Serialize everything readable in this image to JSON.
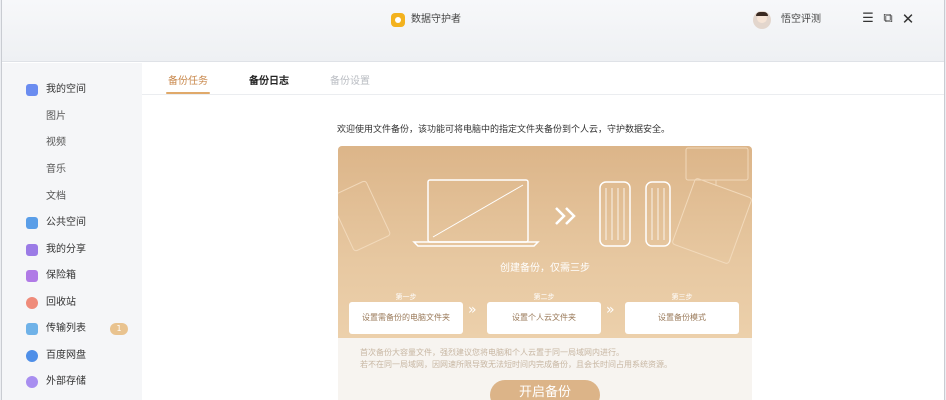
{
  "app": {
    "title": "数据守护者",
    "user_name": "悟空评测"
  },
  "window_controls": {
    "menu": "☰",
    "restore": "⧉",
    "close": "✕"
  },
  "sidebar": {
    "items": [
      {
        "label": "我的空间",
        "icon": "cloud-space-icon",
        "color": "#6a8cf0"
      },
      {
        "label": "图片",
        "sub": true
      },
      {
        "label": "视频",
        "sub": true
      },
      {
        "label": "音乐",
        "sub": true
      },
      {
        "label": "文档",
        "sub": true
      },
      {
        "label": "公共空间",
        "icon": "send-icon",
        "color": "#5a9ee8"
      },
      {
        "label": "我的分享",
        "icon": "share-icon",
        "color": "#9b7be6"
      },
      {
        "label": "保险箱",
        "icon": "safe-icon",
        "color": "#b07ae6"
      },
      {
        "label": "回收站",
        "icon": "recycle-icon",
        "color": "#ef8b7a"
      },
      {
        "label": "传输列表",
        "icon": "transfer-icon",
        "color": "#6fb2e8",
        "badge": "1"
      },
      {
        "label": "百度网盘",
        "icon": "baidu-netdisk-icon",
        "color": "#4f8fe8"
      },
      {
        "label": "外部存储",
        "icon": "external-storage-icon",
        "color": "#a88ef0"
      }
    ]
  },
  "tabs": [
    {
      "label": "备份任务",
      "state": "active"
    },
    {
      "label": "备份日志",
      "state": "bold"
    },
    {
      "label": "备份设置",
      "state": "disabled"
    }
  ],
  "main": {
    "intro": "欢迎使用文件备份，该功能可将电脑中的指定文件夹备份到个人云，守护数据安全。",
    "card_title": "创建备份，仅需三步",
    "steps": [
      {
        "label": "第一步",
        "action": "设置需备份的电脑文件夹"
      },
      {
        "label": "第二步",
        "action": "设置个人云文件夹"
      },
      {
        "label": "第三步",
        "action": "设置备份模式"
      }
    ],
    "step_arrow": "»",
    "notes": [
      "首次备份大容量文件，强烈建议您将电脑和个人云置于同一局域网内进行。",
      "若不在同一局域网，因网速所限导致无法短时间内完成备份，且会长时间占用系统资源。"
    ],
    "start_button": "开启备份"
  },
  "colors": {
    "accent": "#dcb488",
    "active_tab": "#c8874a"
  }
}
